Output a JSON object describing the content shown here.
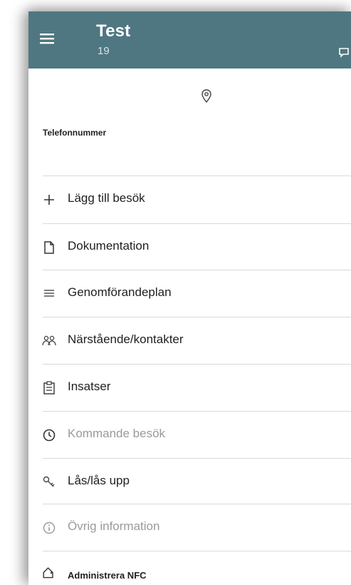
{
  "app": {
    "title": "Test",
    "subtitle": "19"
  },
  "icons": {
    "menu": "menu-icon",
    "chat": "chat-icon",
    "location": "location-pin-icon"
  },
  "colors": {
    "appbar": "#4f7782",
    "text": "#1f1f1f",
    "disabled": "#9a9a9a"
  },
  "contact": {
    "phone_label": "Telefonnummer"
  },
  "menu_items": [
    {
      "label": "Lägg till besök",
      "icon": "plus-icon",
      "enabled": true
    },
    {
      "label": "Dokumentation",
      "icon": "document-icon",
      "enabled": true
    },
    {
      "label": "Genomförandeplan",
      "icon": "list-icon",
      "enabled": true
    },
    {
      "label": "Närstående/kontakter",
      "icon": "people-icon",
      "enabled": true
    },
    {
      "label": "Insatser",
      "icon": "clipboard-icon",
      "enabled": true
    },
    {
      "label": "Kommande besök",
      "icon": "clock-icon",
      "enabled": false
    },
    {
      "label": "Lås/lås upp",
      "icon": "key-icon",
      "enabled": true
    },
    {
      "label": "Övrig information",
      "icon": "info-icon",
      "enabled": false
    },
    {
      "label": "Administrera NFC",
      "icon": "tag-icon",
      "enabled": true
    }
  ]
}
